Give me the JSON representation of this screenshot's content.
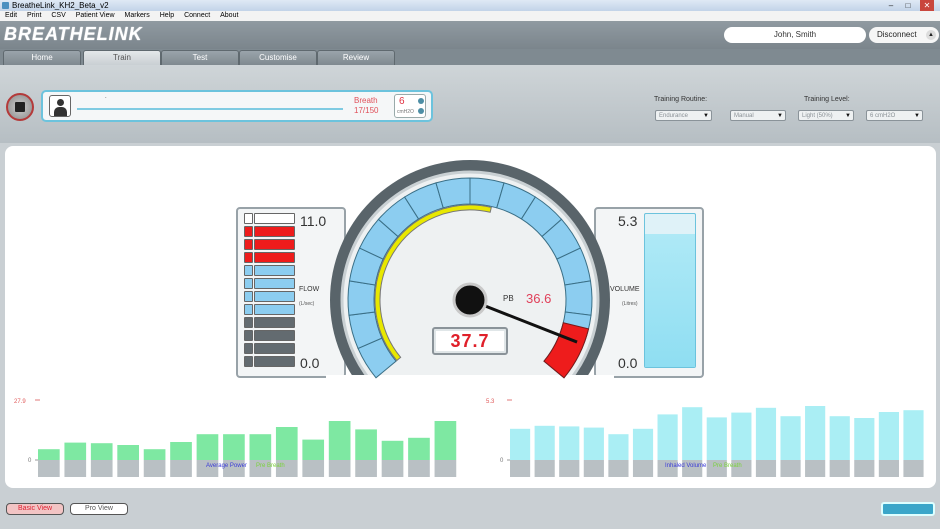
{
  "window": {
    "title": "BreatheLink_KH2_Beta_v2"
  },
  "menu": [
    "Edit",
    "Print",
    "CSV",
    "Patient View",
    "Markers",
    "Help",
    "Connect",
    "About"
  ],
  "header": {
    "logo": "BREATHELINK",
    "patient": "John, Smith",
    "disconnect_label": "Disconnect"
  },
  "tabs": [
    {
      "label": "Home",
      "active": false
    },
    {
      "label": "Train",
      "active": true
    },
    {
      "label": "Test",
      "active": false
    },
    {
      "label": "Customise",
      "active": false
    },
    {
      "label": "Review",
      "active": false
    }
  ],
  "breath": {
    "label": "Breath",
    "count": "17/150",
    "dot": "."
  },
  "resistance": {
    "value": "6",
    "unit": "cmH2O"
  },
  "training": {
    "routine_label": "Training Routine:",
    "level_label": "Training Level:",
    "routine": "Endurance",
    "mode": "Manual",
    "level": "Light (50%)",
    "pressure": "6 cmH2O"
  },
  "flow": {
    "max": "11.0",
    "min": "0.0",
    "label": "FLOW",
    "unit": "(L/sec)",
    "segments": [
      "empty",
      "red",
      "red",
      "red",
      "blue",
      "blue",
      "blue",
      "blue",
      "gray",
      "gray",
      "gray",
      "gray"
    ]
  },
  "volume": {
    "max": "5.3",
    "min": "0.0",
    "label": "VOLUME",
    "unit": "(Litres)",
    "level": 0.87
  },
  "gauge": {
    "pb_label": "PB",
    "pb_value": "36.6",
    "readout": "37.7",
    "needle_fraction": 0.93
  },
  "power_chart": {
    "y_max_label": "27.9",
    "y_min_label": "0",
    "legend_a": "Average Power",
    "legend_b": "Pre Breath",
    "bar_color": "#7ee8a2",
    "values": [
      0.18,
      0.29,
      0.28,
      0.25,
      0.18,
      0.3,
      0.43,
      0.43,
      0.43,
      0.55,
      0.34,
      0.65,
      0.51,
      0.32,
      0.37,
      0.65
    ]
  },
  "volume_chart": {
    "y_max_label": "5.3",
    "y_min_label": "0",
    "legend_a": "Inhaled Volume",
    "legend_b": "Pre Breath",
    "bar_color": "#aaeef4",
    "values": [
      0.52,
      0.57,
      0.56,
      0.54,
      0.43,
      0.52,
      0.76,
      0.88,
      0.71,
      0.79,
      0.87,
      0.73,
      0.9,
      0.73,
      0.7,
      0.8,
      0.83
    ]
  },
  "footer": {
    "basic_view": "Basic View",
    "pro_view": "Pro View"
  }
}
